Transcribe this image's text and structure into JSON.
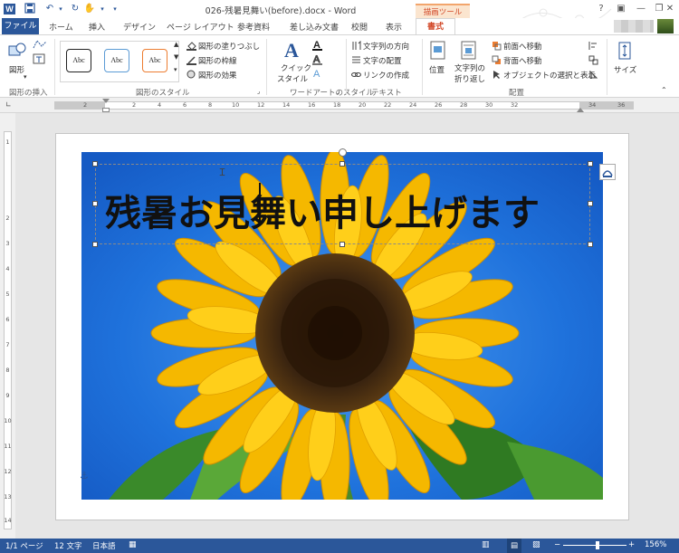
{
  "window": {
    "title": "026-残暑見舞い(before).docx - Word",
    "app_icon": "W",
    "contextual_group": "描画ツール"
  },
  "tabs": [
    {
      "label": "ファイル"
    },
    {
      "label": "ホーム"
    },
    {
      "label": "挿入"
    },
    {
      "label": "デザイン"
    },
    {
      "label": "ページ レイアウト"
    },
    {
      "label": "参考資料"
    },
    {
      "label": "差し込み文書"
    },
    {
      "label": "校閲"
    },
    {
      "label": "表示"
    },
    {
      "label": "書式"
    }
  ],
  "ribbon": {
    "insert_shapes": {
      "label": "図形の挿入",
      "shapes_button": "図形"
    },
    "shape_styles": {
      "label": "図形のスタイル",
      "swatch_text": "Abc",
      "fill": "図形の塗りつぶし",
      "outline": "図形の枠線",
      "effects": "図形の効果"
    },
    "wordart_styles": {
      "label": "ワードアートのスタイル",
      "quick_styles_line1": "クイック",
      "quick_styles_line2": "スタイル"
    },
    "text": {
      "label": "テキスト",
      "direction": "文字列の方向",
      "align": "文字の配置",
      "link": "リンクの作成"
    },
    "arrange": {
      "label": "配置",
      "position": "位置",
      "wrap_line1": "文字列の",
      "wrap_line2": "折り返し",
      "bring_forward": "前面へ移動",
      "send_backward": "背面へ移動",
      "selection_pane": "オブジェクトの選択と表示"
    },
    "size": {
      "label": "サイズ"
    }
  },
  "ruler": {
    "numbers": [
      "2",
      "2",
      "4",
      "6",
      "8",
      "10",
      "12",
      "14",
      "16",
      "18",
      "20",
      "22",
      "24",
      "26",
      "28",
      "30",
      "32",
      "34",
      "36"
    ],
    "vertical_numbers": [
      "1",
      "2",
      "3",
      "4",
      "5",
      "6",
      "7",
      "8",
      "9",
      "10",
      "11",
      "12",
      "13",
      "14"
    ]
  },
  "document": {
    "headline": "残暑お見舞い申し上げます"
  },
  "status": {
    "page": "1/1 ページ",
    "words": "12 文字",
    "language": "日本語",
    "zoom": "156%",
    "zoom_minus": "−",
    "zoom_plus": "+"
  },
  "colors": {
    "word_blue": "#2b579a",
    "accent_orange": "#d24726",
    "sky_blue": "#1f72dc",
    "petal_yellow": "#f5b800",
    "center_brown": "#3a2410"
  }
}
